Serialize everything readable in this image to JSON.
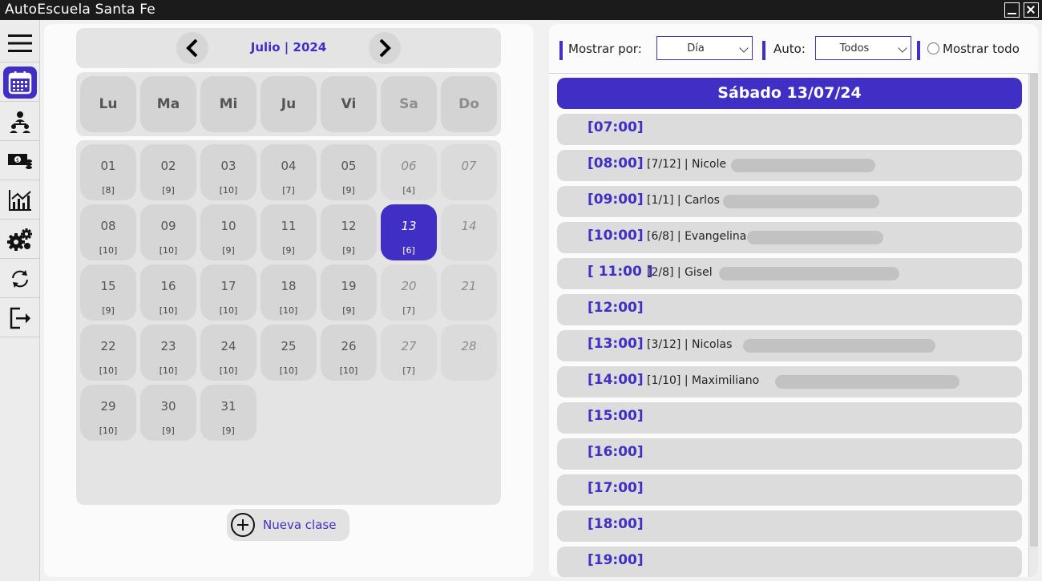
{
  "window": {
    "title": "AutoEscuela Santa Fe"
  },
  "sidebar": {
    "items": [
      {
        "icon": "hamburger-menu-icon"
      },
      {
        "icon": "calendar-icon",
        "active": true
      },
      {
        "icon": "users-hierarchy-icon"
      },
      {
        "icon": "money-icon"
      },
      {
        "icon": "bar-chart-icon"
      },
      {
        "icon": "gears-icon"
      },
      {
        "icon": "sync-icon"
      },
      {
        "icon": "logout-icon"
      }
    ]
  },
  "calendar": {
    "month_label": "Julio | 2024",
    "weekdays": [
      "Lu",
      "Ma",
      "Mi",
      "Ju",
      "Vi",
      "Sa",
      "Do"
    ],
    "days": [
      {
        "num": "01",
        "count": "[8]"
      },
      {
        "num": "02",
        "count": "[9]"
      },
      {
        "num": "03",
        "count": "[10]"
      },
      {
        "num": "04",
        "count": "[7]"
      },
      {
        "num": "05",
        "count": "[9]"
      },
      {
        "num": "06",
        "count": "[4]"
      },
      {
        "num": "07",
        "count": ""
      },
      {
        "num": "08",
        "count": "[10]"
      },
      {
        "num": "09",
        "count": "[10]"
      },
      {
        "num": "10",
        "count": "[9]"
      },
      {
        "num": "11",
        "count": "[9]"
      },
      {
        "num": "12",
        "count": "[9]"
      },
      {
        "num": "13",
        "count": "[6]",
        "selected": true
      },
      {
        "num": "14",
        "count": ""
      },
      {
        "num": "15",
        "count": "[9]"
      },
      {
        "num": "16",
        "count": "[10]"
      },
      {
        "num": "17",
        "count": "[10]"
      },
      {
        "num": "18",
        "count": "[10]"
      },
      {
        "num": "19",
        "count": "[9]"
      },
      {
        "num": "20",
        "count": "[7]"
      },
      {
        "num": "21",
        "count": ""
      },
      {
        "num": "22",
        "count": "[10]"
      },
      {
        "num": "23",
        "count": "[10]"
      },
      {
        "num": "24",
        "count": "[10]"
      },
      {
        "num": "25",
        "count": "[10]"
      },
      {
        "num": "26",
        "count": "[10]"
      },
      {
        "num": "27",
        "count": "[7]"
      },
      {
        "num": "28",
        "count": ""
      },
      {
        "num": "29",
        "count": "[10]"
      },
      {
        "num": "30",
        "count": "[9]"
      },
      {
        "num": "31",
        "count": "[9]"
      }
    ],
    "new_class_label": "Nueva clase"
  },
  "filters": {
    "show_by_label": "Mostrar por:",
    "show_by_value": "Día",
    "auto_label": "Auto:",
    "auto_value": "Todos",
    "show_all_label": "Mostrar todo"
  },
  "schedule": {
    "date_header": "Sábado 13/07/24",
    "slots": [
      {
        "time": "[07:00]",
        "text": ""
      },
      {
        "time": "[08:00]",
        "text": "[7/12] | Nicole"
      },
      {
        "time": "[09:00]",
        "text": "[1/1] | Carlos"
      },
      {
        "time": "[10:00]",
        "text": "[6/8] | Evangelina"
      },
      {
        "time": "[ 11:00 ]",
        "text": "[2/8] | Gisel"
      },
      {
        "time": "[12:00]",
        "text": ""
      },
      {
        "time": "[13:00]",
        "text": "[3/12] | Nicolas"
      },
      {
        "time": "[14:00]",
        "text": "[1/10] | Maximiliano"
      },
      {
        "time": "[15:00]",
        "text": ""
      },
      {
        "time": "[16:00]",
        "text": ""
      },
      {
        "time": "[17:00]",
        "text": ""
      },
      {
        "time": "[18:00]",
        "text": ""
      },
      {
        "time": "[19:00]",
        "text": ""
      }
    ]
  },
  "colors": {
    "accent": "#3f2fc4",
    "titlebar": "#1b1b1b"
  }
}
